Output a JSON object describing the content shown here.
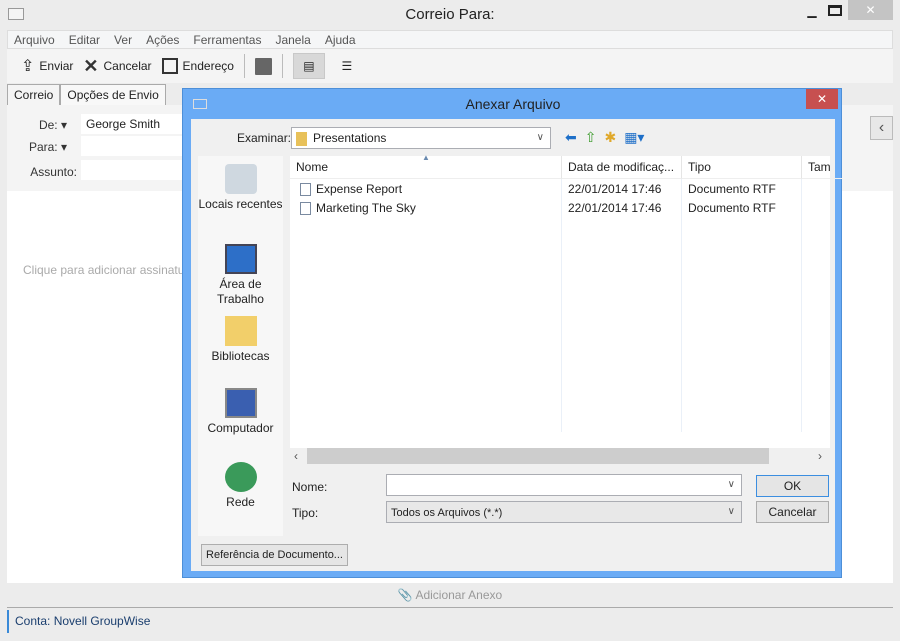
{
  "window": {
    "title": "Correio Para:"
  },
  "menu": [
    "Arquivo",
    "Editar",
    "Ver",
    "Ações",
    "Ferramentas",
    "Janela",
    "Ajuda"
  ],
  "toolbar": {
    "send": "Enviar",
    "cancel": "Cancelar",
    "address": "Endereço"
  },
  "tabs": [
    "Correio",
    "Opções de Envio"
  ],
  "form": {
    "from_label": "De:",
    "from_value": "George Smith",
    "to_label": "Para:",
    "subject_label": "Assunto:"
  },
  "body": {
    "signature_placeholder": "Clique para adicionar assinatura"
  },
  "attach": {
    "label": "Adicionar Anexo"
  },
  "status": {
    "account": "Conta: Novell GroupWise"
  },
  "dialog": {
    "title": "Anexar Arquivo",
    "look_in_label": "Examinar:",
    "look_in_value": "Presentations",
    "places": [
      "Locais recentes",
      "Área de Trabalho",
      "Bibliotecas",
      "Computador",
      "Rede"
    ],
    "columns": [
      "Nome",
      "Data de modificaç...",
      "Tipo",
      "Tam"
    ],
    "files": [
      {
        "name": "Expense Report",
        "date": "22/01/2014 17:46",
        "type": "Documento RTF"
      },
      {
        "name": "Marketing The Sky",
        "date": "22/01/2014 17:46",
        "type": "Documento RTF"
      }
    ],
    "name_label": "Nome:",
    "name_value": "",
    "type_label": "Tipo:",
    "type_value": "Todos os Arquivos (*.*)",
    "ok": "OK",
    "cancel": "Cancelar",
    "doc_ref": "Referência de Documento..."
  }
}
